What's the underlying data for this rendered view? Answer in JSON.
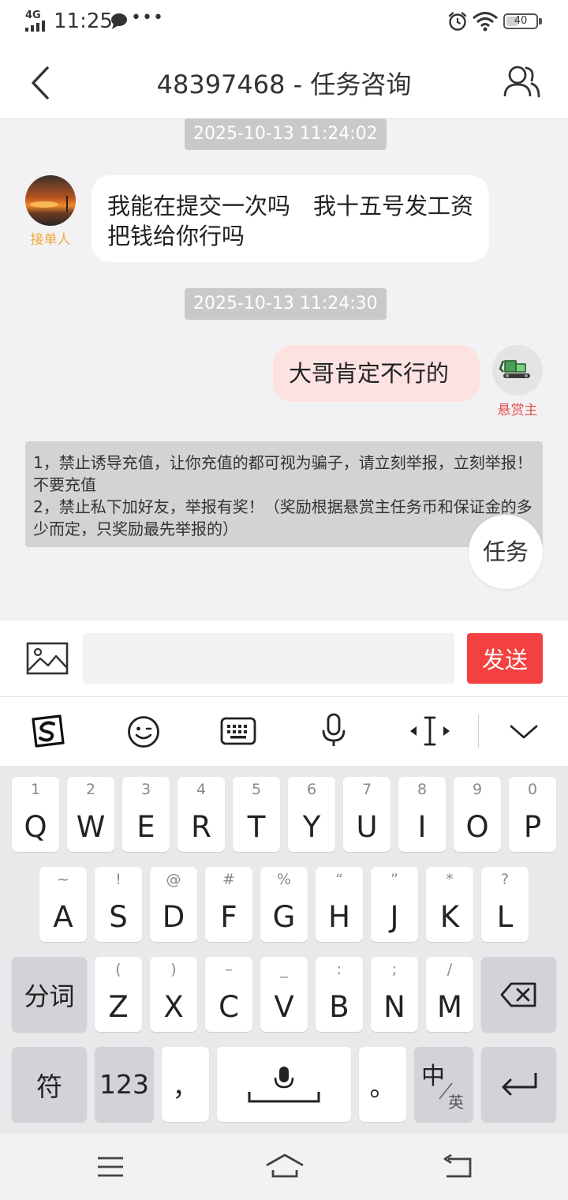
{
  "status_bar": {
    "network": "4G",
    "time": "11:25",
    "battery": "40",
    "battery_level": 0.4,
    "icons": [
      "signal-icon",
      "message-icon",
      "more-dots-icon",
      "alarm-icon",
      "wifi-icon",
      "battery-icon"
    ]
  },
  "header": {
    "title": "48397468 - 任务咨询",
    "back_icon": "chevron-left-icon",
    "people_icon": "users-icon"
  },
  "chat": {
    "messages": [
      {
        "timestamp": "2025-10-13 11:24:02",
        "side": "left",
        "role": "接单人",
        "text": "我能在提交一次吗　我十五号发工资把钱给你行吗"
      },
      {
        "timestamp": "2025-10-13 11:24:30",
        "side": "right",
        "role": "悬赏主",
        "text": "大哥肯定不行的"
      }
    ],
    "notice": "1，禁止诱导充值，让你充值的都可视为骗子，请立刻举报，立刻举报！不要充值\n2，禁止私下加好友，举报有奖！（奖励根据悬赏主任务币和保证金的多少而定，只奖励最先举报的）",
    "task_button": "任务"
  },
  "input": {
    "placeholder": "",
    "value": "",
    "send_label": "发送",
    "image_icon": "image-icon"
  },
  "keyboard_toolbar": {
    "icons": [
      "sogou-logo-icon",
      "emoji-icon",
      "keyboard-icon",
      "microphone-icon",
      "cursor-move-icon",
      "chevron-down-icon"
    ]
  },
  "keyboard": {
    "row1": [
      {
        "key": "Q",
        "sub": "1"
      },
      {
        "key": "W",
        "sub": "2"
      },
      {
        "key": "E",
        "sub": "3"
      },
      {
        "key": "R",
        "sub": "4"
      },
      {
        "key": "T",
        "sub": "5"
      },
      {
        "key": "Y",
        "sub": "6"
      },
      {
        "key": "U",
        "sub": "7"
      },
      {
        "key": "I",
        "sub": "8"
      },
      {
        "key": "O",
        "sub": "9"
      },
      {
        "key": "P",
        "sub": "0"
      }
    ],
    "row2": [
      {
        "key": "A",
        "sub": "~"
      },
      {
        "key": "S",
        "sub": "!"
      },
      {
        "key": "D",
        "sub": "@"
      },
      {
        "key": "F",
        "sub": "#"
      },
      {
        "key": "G",
        "sub": "%"
      },
      {
        "key": "H",
        "sub": "“"
      },
      {
        "key": "J",
        "sub": "”"
      },
      {
        "key": "K",
        "sub": "*"
      },
      {
        "key": "L",
        "sub": "?"
      }
    ],
    "row3": [
      {
        "key": "Z",
        "sub": "("
      },
      {
        "key": "X",
        "sub": ")"
      },
      {
        "key": "C",
        "sub": "–"
      },
      {
        "key": "V",
        "sub": "_"
      },
      {
        "key": "B",
        "sub": ":"
      },
      {
        "key": "N",
        "sub": ";"
      },
      {
        "key": "M",
        "sub": "/"
      }
    ],
    "segment_key": "分词",
    "symbol_key": "符",
    "number_key": "123",
    "comma_key": "，",
    "period_key": "。",
    "lang_key_primary": "中",
    "lang_key_secondary": "英",
    "backspace_icon": "backspace-icon",
    "space_icon": "space-mic-icon",
    "enter_icon": "enter-icon"
  },
  "nav_bar": {
    "icons": [
      "menu-icon",
      "home-icon",
      "back-nav-icon"
    ]
  }
}
